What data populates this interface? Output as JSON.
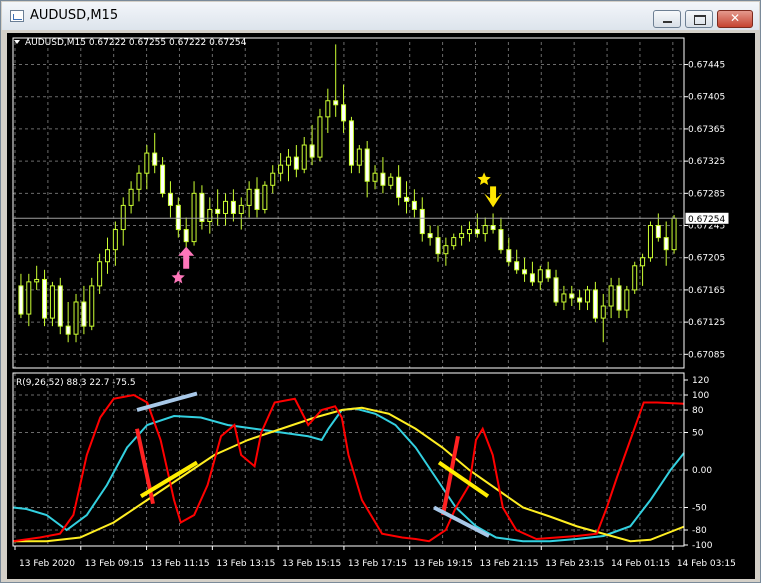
{
  "window": {
    "title": "AUDUSD,M15"
  },
  "main_chart": {
    "header": "AUDUSD,M15  0.67222 0.67255 0.67222 0.67254",
    "current_price": "0.67254",
    "y_ticks": [
      "0.67445",
      "0.67405",
      "0.67365",
      "0.67325",
      "0.67285",
      "0.67245",
      "0.67205",
      "0.67165",
      "0.67125",
      "0.67085"
    ],
    "bull_color": "#ccff33",
    "bear_color": "#ffffff",
    "buy_arrow_color": "#ff77bb",
    "sell_arrow_color": "#ffe600"
  },
  "indicator": {
    "header": "R(9,26,52) 88.3 22.7 -75.5",
    "y_ticks": [
      "120",
      "100",
      "80",
      "50",
      "0.00",
      "-50",
      "-80",
      "-100"
    ],
    "colors": {
      "fast": "#ff0000",
      "mid": "#33d0e0",
      "slow": "#ffee22"
    },
    "annotation_colors": {
      "red_line": "#ff2222",
      "yellow_line": "#ffee00",
      "blue_line": "#a8c8e8"
    }
  },
  "x_labels": [
    "13 Feb 2020",
    "13 Feb 09:15",
    "13 Feb 11:15",
    "13 Feb 13:15",
    "13 Feb 15:15",
    "13 Feb 17:15",
    "13 Feb 19:15",
    "13 Feb 21:15",
    "13 Feb 23:15",
    "14 Feb 01:15",
    "14 Feb 03:15"
  ],
  "chart_data": {
    "type": "candlestick",
    "symbol": "AUDUSD",
    "timeframe": "M15",
    "ohlc_last": {
      "open": 0.67222,
      "high": 0.67255,
      "low": 0.67222,
      "close": 0.67254
    },
    "price_range": [
      0.67068,
      0.67473
    ],
    "candles": [
      [
        0.6717,
        0.67185,
        0.6713,
        0.67135
      ],
      [
        0.67135,
        0.67185,
        0.6712,
        0.67175
      ],
      [
        0.67175,
        0.67195,
        0.67165,
        0.67178
      ],
      [
        0.67178,
        0.6719,
        0.6712,
        0.6713
      ],
      [
        0.6713,
        0.67175,
        0.6712,
        0.6717
      ],
      [
        0.6717,
        0.6718,
        0.6711,
        0.6712
      ],
      [
        0.6712,
        0.6715,
        0.671,
        0.6711
      ],
      [
        0.6711,
        0.6716,
        0.671,
        0.6715
      ],
      [
        0.6715,
        0.6717,
        0.6711,
        0.6712
      ],
      [
        0.6712,
        0.6718,
        0.67115,
        0.6717
      ],
      [
        0.6717,
        0.6721,
        0.6716,
        0.672
      ],
      [
        0.672,
        0.6723,
        0.67185,
        0.67215
      ],
      [
        0.67215,
        0.6725,
        0.67195,
        0.6724
      ],
      [
        0.6724,
        0.6728,
        0.6722,
        0.6727
      ],
      [
        0.6727,
        0.673,
        0.6726,
        0.6729
      ],
      [
        0.6729,
        0.6732,
        0.67275,
        0.6731
      ],
      [
        0.6731,
        0.67345,
        0.6729,
        0.67335
      ],
      [
        0.67335,
        0.6736,
        0.6731,
        0.6732
      ],
      [
        0.6732,
        0.6733,
        0.6728,
        0.67285
      ],
      [
        0.67285,
        0.673,
        0.67255,
        0.6727
      ],
      [
        0.6727,
        0.6728,
        0.6723,
        0.6724
      ],
      [
        0.6724,
        0.67255,
        0.67205,
        0.67225
      ],
      [
        0.67225,
        0.673,
        0.6722,
        0.67285
      ],
      [
        0.67285,
        0.67295,
        0.6724,
        0.6725
      ],
      [
        0.6725,
        0.6728,
        0.67235,
        0.67265
      ],
      [
        0.67265,
        0.6729,
        0.67245,
        0.6726
      ],
      [
        0.6726,
        0.67285,
        0.67245,
        0.67275
      ],
      [
        0.67275,
        0.6729,
        0.6725,
        0.6726
      ],
      [
        0.6726,
        0.6728,
        0.6724,
        0.6727
      ],
      [
        0.6727,
        0.673,
        0.67255,
        0.6729
      ],
      [
        0.6729,
        0.67305,
        0.67255,
        0.67265
      ],
      [
        0.67265,
        0.673,
        0.6726,
        0.67295
      ],
      [
        0.67295,
        0.6732,
        0.67285,
        0.6731
      ],
      [
        0.6731,
        0.67335,
        0.673,
        0.6732
      ],
      [
        0.6732,
        0.6734,
        0.673,
        0.6733
      ],
      [
        0.6733,
        0.67345,
        0.67305,
        0.67315
      ],
      [
        0.67315,
        0.67355,
        0.6731,
        0.67345
      ],
      [
        0.67345,
        0.6737,
        0.6732,
        0.6733
      ],
      [
        0.6733,
        0.6739,
        0.67325,
        0.6738
      ],
      [
        0.6738,
        0.67415,
        0.6736,
        0.674
      ],
      [
        0.674,
        0.6747,
        0.6738,
        0.67395
      ],
      [
        0.67395,
        0.6742,
        0.6736,
        0.67375
      ],
      [
        0.67375,
        0.6738,
        0.6731,
        0.6732
      ],
      [
        0.6732,
        0.67345,
        0.6731,
        0.6734
      ],
      [
        0.6734,
        0.6735,
        0.6728,
        0.673
      ],
      [
        0.673,
        0.6732,
        0.6729,
        0.6731
      ],
      [
        0.6731,
        0.6733,
        0.67285,
        0.67295
      ],
      [
        0.67295,
        0.6731,
        0.6729,
        0.67305
      ],
      [
        0.67305,
        0.6732,
        0.6727,
        0.6728
      ],
      [
        0.6728,
        0.673,
        0.6726,
        0.67275
      ],
      [
        0.67275,
        0.6729,
        0.67255,
        0.67265
      ],
      [
        0.67265,
        0.6728,
        0.67225,
        0.67235
      ],
      [
        0.67235,
        0.67245,
        0.6722,
        0.6723
      ],
      [
        0.6723,
        0.67245,
        0.672,
        0.6721
      ],
      [
        0.6721,
        0.6723,
        0.67195,
        0.6722
      ],
      [
        0.6722,
        0.67235,
        0.67215,
        0.6723
      ],
      [
        0.6723,
        0.67245,
        0.6722,
        0.67235
      ],
      [
        0.67235,
        0.6725,
        0.67225,
        0.6724
      ],
      [
        0.6724,
        0.6726,
        0.6723,
        0.67235
      ],
      [
        0.67235,
        0.67255,
        0.67225,
        0.67245
      ],
      [
        0.67245,
        0.6726,
        0.67235,
        0.6724
      ],
      [
        0.6724,
        0.67255,
        0.6721,
        0.67215
      ],
      [
        0.67215,
        0.6723,
        0.67195,
        0.672
      ],
      [
        0.672,
        0.67215,
        0.67185,
        0.6719
      ],
      [
        0.6719,
        0.67205,
        0.67175,
        0.67185
      ],
      [
        0.67185,
        0.672,
        0.6717,
        0.67175
      ],
      [
        0.67175,
        0.67195,
        0.67165,
        0.6719
      ],
      [
        0.6719,
        0.672,
        0.67175,
        0.6718
      ],
      [
        0.6718,
        0.6719,
        0.67145,
        0.6715
      ],
      [
        0.6715,
        0.6717,
        0.6714,
        0.6716
      ],
      [
        0.6716,
        0.6717,
        0.67145,
        0.67155
      ],
      [
        0.67155,
        0.67165,
        0.6714,
        0.6715
      ],
      [
        0.6715,
        0.6717,
        0.6714,
        0.67165
      ],
      [
        0.67165,
        0.67175,
        0.67125,
        0.6713
      ],
      [
        0.6713,
        0.6716,
        0.671,
        0.67145
      ],
      [
        0.67145,
        0.6718,
        0.6713,
        0.6717
      ],
      [
        0.6717,
        0.6718,
        0.6713,
        0.6714
      ],
      [
        0.6714,
        0.6717,
        0.6713,
        0.67165
      ],
      [
        0.67165,
        0.672,
        0.6716,
        0.67195
      ],
      [
        0.67195,
        0.6721,
        0.6717,
        0.67205
      ],
      [
        0.67205,
        0.6725,
        0.672,
        0.67245
      ],
      [
        0.67245,
        0.6726,
        0.67225,
        0.6723
      ],
      [
        0.6723,
        0.6725,
        0.67195,
        0.67215
      ],
      [
        0.67215,
        0.67258,
        0.6721,
        0.67254
      ]
    ],
    "indicator": {
      "name": "R(9,26,52)",
      "range": [
        -100,
        120
      ],
      "current_values": [
        88.3,
        22.7,
        -75.5
      ]
    }
  }
}
